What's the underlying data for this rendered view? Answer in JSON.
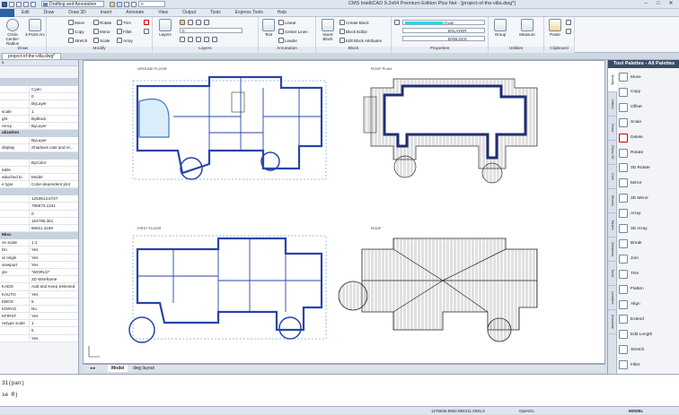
{
  "app": {
    "title": "CMS IntelliCAD 9.2x64 Premium Edition Plus Net - [project-of-the-villa.dwg*]",
    "workspace": "Drafting and Annotation",
    "layer_state_value": "0",
    "window_buttons": [
      "–",
      "□",
      "✕"
    ]
  },
  "menu_tabs": [
    "Edit",
    "Draw",
    "Draw 3D",
    "Insert",
    "Annotate",
    "View",
    "Output",
    "Tools",
    "Express Tools",
    "Help"
  ],
  "ribbon": {
    "draw": {
      "label": "Draw",
      "items": [
        "Circle Center-Radius",
        "3-Point Arc"
      ]
    },
    "modify": {
      "label": "Modify",
      "items": [
        "Move",
        "Rotate",
        "Trim",
        "Copy",
        "Mirror",
        "Fillet",
        "Stretch",
        "Scale",
        "Array"
      ]
    },
    "layers": {
      "label": "Layers",
      "big": "Layers",
      "combo_value": "0"
    },
    "annotation": {
      "label": "Annotation",
      "big": "Text",
      "items": [
        "Linear",
        "Center Lines",
        "Leader"
      ]
    },
    "block": {
      "label": "Block",
      "big": "Insert Block",
      "items": [
        "Create Block",
        "Block Editor",
        "Edit Block Attributes"
      ]
    },
    "properties": {
      "label": "Properties",
      "color": "Cyan",
      "linetype": "BYLAYER",
      "lineweight": "BYBLOCK"
    },
    "utilities": {
      "label": "Utilities",
      "items": [
        "Group",
        "Measure"
      ]
    },
    "clipboard": {
      "label": "Clipboard",
      "items": [
        "Paste"
      ]
    }
  },
  "document_tab": "project-of-the-villa.dwg*",
  "properties_panel": {
    "header": "s",
    "rows1": [
      [
        "",
        "Cyan"
      ],
      [
        "",
        "0"
      ],
      [
        "",
        "ByLayer"
      ],
      [
        "scale",
        "1"
      ],
      [
        "ght",
        "ByBlock"
      ],
      [
        "rency",
        "ByLayer"
      ]
    ],
    "section2": "alization",
    "rows2": [
      [
        "",
        "ByLayer"
      ],
      [
        "display",
        "Shadows cast and re..."
      ]
    ],
    "section3": "",
    "rows3": [
      [
        "",
        "ByColor"
      ],
      [
        "table",
        ""
      ],
      [
        "attached to",
        "Model"
      ],
      [
        "e type",
        "Color-dependent plot"
      ]
    ],
    "rows4": [
      [
        "",
        "1253613.6727"
      ],
      [
        "",
        "786873.1341"
      ],
      [
        "",
        "0"
      ],
      [
        "",
        "154780.361"
      ],
      [
        "",
        "86811.3189"
      ]
    ],
    "section4": "Misc",
    "rows5": [
      [
        "on scale",
        "1:1"
      ],
      [
        "Dn",
        "Yes"
      ],
      [
        "at origin",
        "Yes"
      ],
      [
        "viewport",
        "Yes"
      ],
      [
        "yle",
        "\"WORLD\""
      ],
      [
        "",
        "2D Wireframe"
      ],
      [
        "KADD",
        "Add and Keep Selected"
      ],
      [
        "KAUTO",
        "Yes"
      ],
      [
        "KBOX",
        "5"
      ],
      [
        "KDRAG",
        "No"
      ],
      [
        "KFIRST",
        "Yes"
      ],
      [
        "netype scale",
        "1"
      ],
      [
        "",
        "5"
      ],
      [
        "",
        "Yes"
      ]
    ]
  },
  "canvas": {
    "plan_labels": [
      "GROUND FLOOR",
      "ROOF PLAN",
      "FIRST FLOOR",
      "ROOF"
    ]
  },
  "model_tabs": [
    "Model",
    "dwg layout"
  ],
  "tool_palette": {
    "title": "Tool Palettes - All Palettes",
    "tabs": [
      "Modify",
      "Hatch",
      "Draw",
      "Draw 3D",
      "Civil",
      "Blocks",
      "Tables",
      "Windows",
      "Tools",
      "Leaders",
      "Annotate"
    ],
    "items": [
      "Move",
      "Copy",
      "Offset",
      "Scale",
      "Delete",
      "Rotate",
      "3D Rotate",
      "Mirror",
      "3D Mirror",
      "Array",
      "3D Array",
      "Break",
      "Join",
      "Trim",
      "Flatten",
      "Align",
      "Extend",
      "Edit Length",
      "Stretch",
      "Fillet"
    ]
  },
  "command_line": {
    "line1": "31(pan)",
    "line2": "se R)"
  },
  "status_bar": {
    "coords": "1275845.9502,992411.2931,0",
    "items": [
      "OpenGL",
      "MODEL"
    ]
  }
}
